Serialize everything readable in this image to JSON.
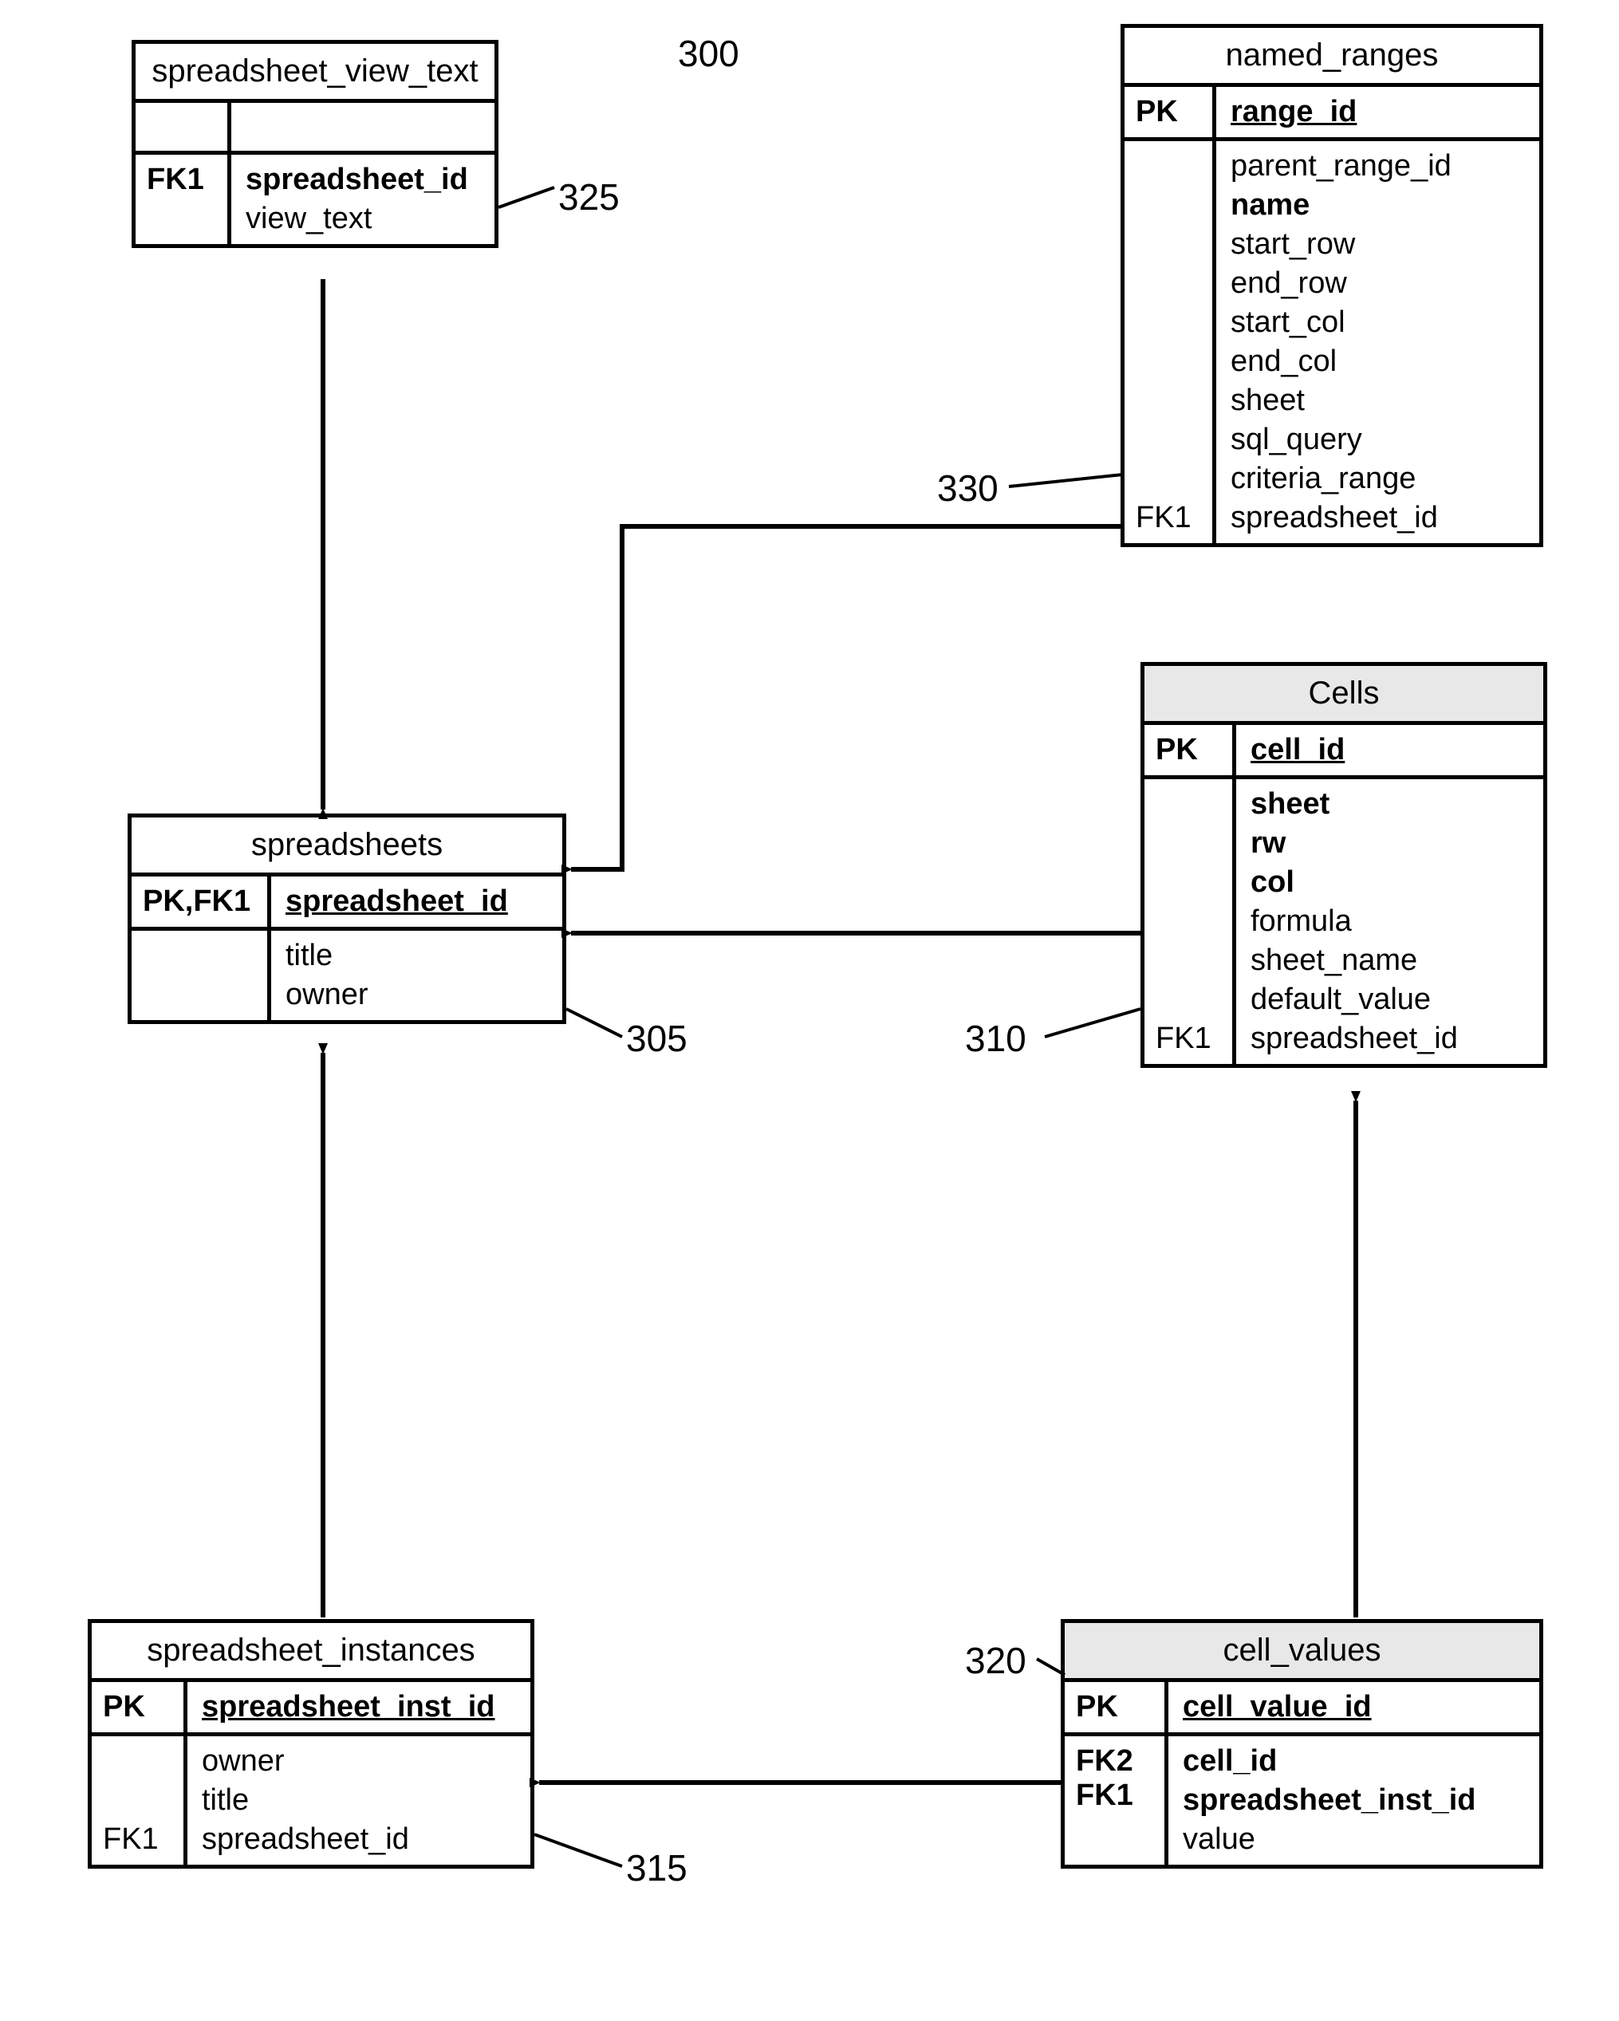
{
  "diagram_number": "300",
  "labels": {
    "l305": "305",
    "l310": "310",
    "l315": "315",
    "l320": "320",
    "l325": "325",
    "l330": "330"
  },
  "entities": {
    "svt": {
      "title": "spreadsheet_view_text",
      "pk_key": "FK1",
      "pk_field": "spreadsheet_id",
      "body_key": "",
      "fields": [
        "view_text"
      ]
    },
    "nr": {
      "title": "named_ranges",
      "pk_key": "PK",
      "pk_field": "range_id",
      "body_key_top": "",
      "body_key_bot": "FK1",
      "fields": [
        "parent_range_id",
        "name",
        "start_row",
        "end_row",
        "start_col",
        "end_col",
        "sheet",
        "sql_query",
        "criteria_range",
        "spreadsheet_id"
      ],
      "bold_fields": [
        "name"
      ]
    },
    "cells": {
      "title": "Cells",
      "pk_key": "PK",
      "pk_field": "cell_id",
      "body_key_bot": "FK1",
      "fields": [
        "sheet",
        "rw",
        "col",
        "formula",
        "sheet_name",
        "default_value",
        "spreadsheet_id"
      ],
      "bold_fields": [
        "sheet",
        "rw",
        "col"
      ]
    },
    "ss": {
      "title": "spreadsheets",
      "pk_key": "PK,FK1",
      "pk_field": "spreadsheet_id",
      "body_key": "",
      "fields": [
        "title",
        "owner"
      ]
    },
    "si": {
      "title": "spreadsheet_instances",
      "pk_key": "PK",
      "pk_field": "spreadsheet_inst_id",
      "body_key_bot": "FK1",
      "fields": [
        "owner",
        "title",
        "spreadsheet_id"
      ]
    },
    "cv": {
      "title": "cell_values",
      "pk_key": "PK",
      "pk_field": "cell_value_id",
      "body_keys": [
        "FK2",
        "FK1"
      ],
      "fields": [
        "cell_id",
        "spreadsheet_inst_id",
        "value"
      ],
      "bold_fields": [
        "cell_id",
        "spreadsheet_inst_id"
      ]
    }
  }
}
